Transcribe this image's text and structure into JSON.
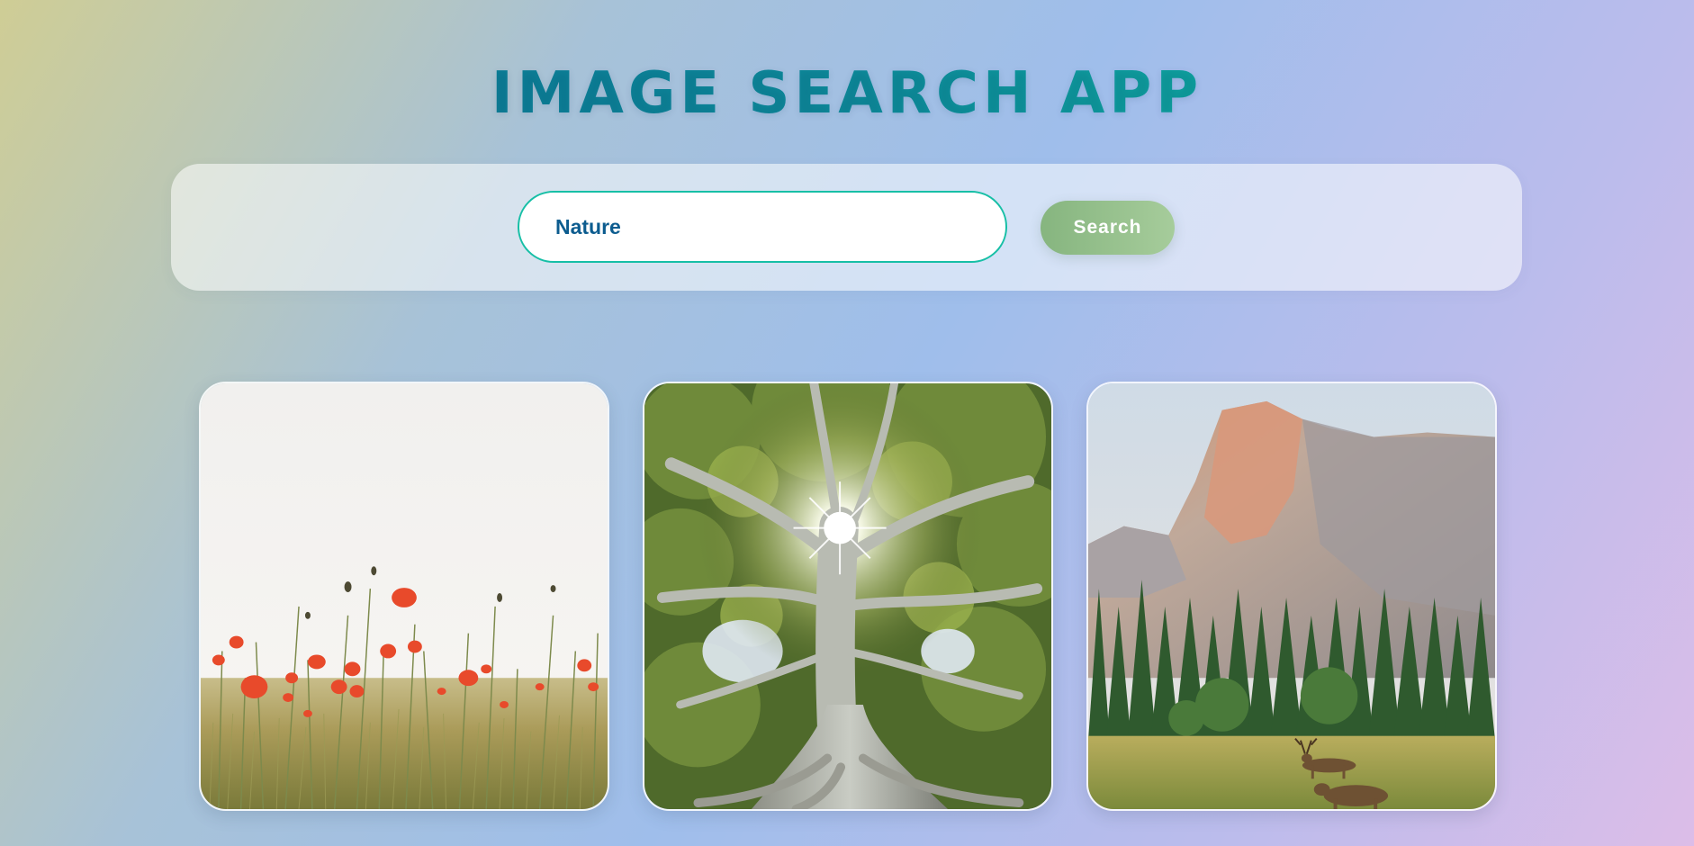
{
  "header": {
    "title": "IMAGE SEARCH APP"
  },
  "search": {
    "value": "Nature",
    "button_label": "Search"
  },
  "results": [
    {
      "subject": "poppy-field"
    },
    {
      "subject": "sunlit-tree"
    },
    {
      "subject": "mountain-valley-deer"
    }
  ],
  "colors": {
    "title_gradient_start": "#0a6e93",
    "title_gradient_end": "#10c3a5",
    "input_border": "#17bfa6",
    "input_text": "#0c5c8f",
    "button_start": "#86b57f",
    "button_end": "#a6cc9b"
  }
}
